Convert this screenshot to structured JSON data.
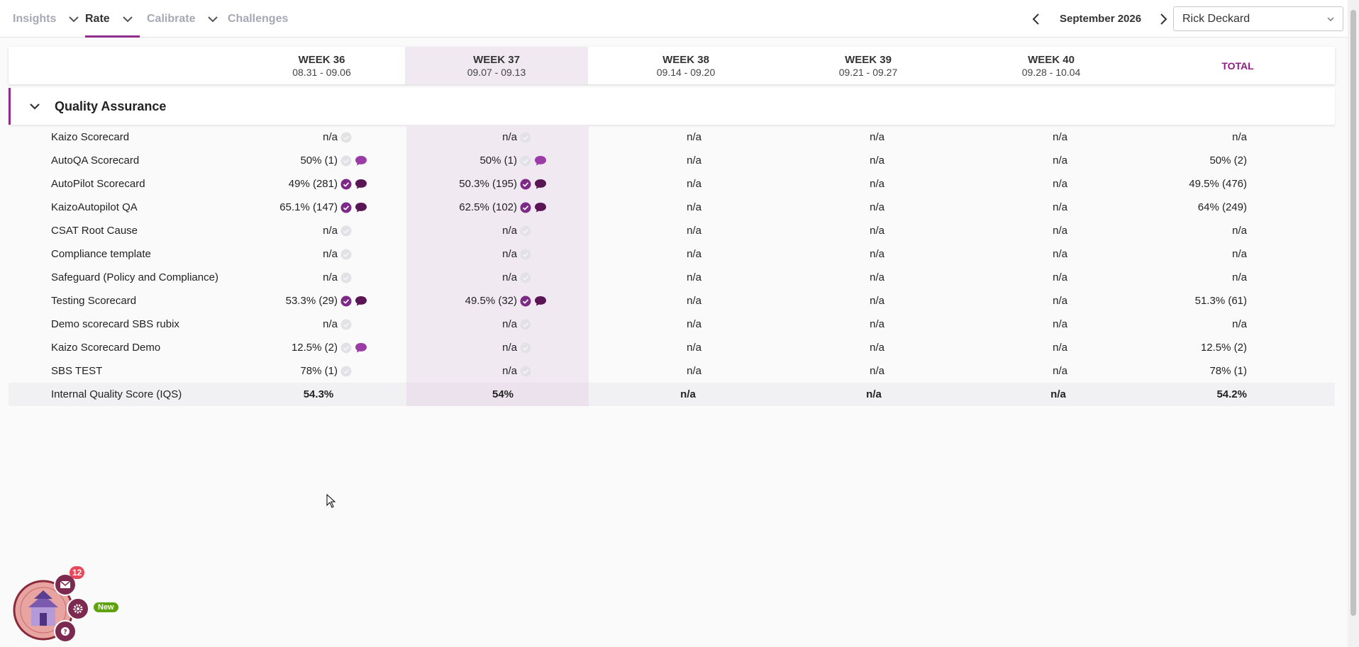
{
  "nav": {
    "items": [
      {
        "label": "Insights",
        "has_dropdown": true,
        "active": false
      },
      {
        "label": "Rate",
        "has_dropdown": true,
        "active": true
      },
      {
        "label": "Calibrate",
        "has_dropdown": true,
        "active": false
      },
      {
        "label": "Challenges",
        "has_dropdown": false,
        "active": false
      }
    ]
  },
  "period": {
    "month_label": "September 2026"
  },
  "user_select": {
    "value": "Rick Deckard"
  },
  "columns": [
    {
      "week": "WEEK 36",
      "range": "08.31 - 09.06"
    },
    {
      "week": "WEEK 37",
      "range": "09.07 - 09.13"
    },
    {
      "week": "WEEK 38",
      "range": "09.14 - 09.20"
    },
    {
      "week": "WEEK 39",
      "range": "09.21 - 09.27"
    },
    {
      "week": "WEEK 40",
      "range": "09.28 - 10.04"
    }
  ],
  "total_label": "TOTAL",
  "section": {
    "title": "Quality Assurance"
  },
  "rows": [
    {
      "label": "Kaizo Scorecard",
      "cells": [
        {
          "v": "n/a",
          "check": "off",
          "chat": "none"
        },
        {
          "v": "n/a",
          "check": "off",
          "chat": "none"
        },
        {
          "v": "n/a"
        },
        {
          "v": "n/a"
        },
        {
          "v": "n/a"
        }
      ],
      "total": "n/a"
    },
    {
      "label": "AutoQA Scorecard",
      "cells": [
        {
          "v": "50% (1)",
          "check": "off",
          "chat": "light"
        },
        {
          "v": "50% (1)",
          "check": "off",
          "chat": "light"
        },
        {
          "v": "n/a"
        },
        {
          "v": "n/a"
        },
        {
          "v": "n/a"
        }
      ],
      "total": "50% (2)"
    },
    {
      "label": "AutoPilot Scorecard",
      "cells": [
        {
          "v": "49% (281)",
          "check": "on",
          "chat": "dark"
        },
        {
          "v": "50.3% (195)",
          "check": "on",
          "chat": "dark"
        },
        {
          "v": "n/a"
        },
        {
          "v": "n/a"
        },
        {
          "v": "n/a"
        }
      ],
      "total": "49.5% (476)"
    },
    {
      "label": "KaizoAutopilot QA",
      "cells": [
        {
          "v": "65.1% (147)",
          "check": "on",
          "chat": "dark"
        },
        {
          "v": "62.5% (102)",
          "check": "on",
          "chat": "dark"
        },
        {
          "v": "n/a"
        },
        {
          "v": "n/a"
        },
        {
          "v": "n/a"
        }
      ],
      "total": "64% (249)"
    },
    {
      "label": "CSAT Root Cause",
      "cells": [
        {
          "v": "n/a",
          "check": "off",
          "chat": "none"
        },
        {
          "v": "n/a",
          "check": "off",
          "chat": "none"
        },
        {
          "v": "n/a"
        },
        {
          "v": "n/a"
        },
        {
          "v": "n/a"
        }
      ],
      "total": "n/a"
    },
    {
      "label": "Compliance template",
      "cells": [
        {
          "v": "n/a",
          "check": "off",
          "chat": "none"
        },
        {
          "v": "n/a",
          "check": "off",
          "chat": "none"
        },
        {
          "v": "n/a"
        },
        {
          "v": "n/a"
        },
        {
          "v": "n/a"
        }
      ],
      "total": "n/a"
    },
    {
      "label": "Safeguard (Policy and Compliance)",
      "cells": [
        {
          "v": "n/a",
          "check": "off",
          "chat": "none"
        },
        {
          "v": "n/a",
          "check": "off",
          "chat": "none"
        },
        {
          "v": "n/a"
        },
        {
          "v": "n/a"
        },
        {
          "v": "n/a"
        }
      ],
      "total": "n/a"
    },
    {
      "label": "Testing Scorecard",
      "cells": [
        {
          "v": "53.3% (29)",
          "check": "on",
          "chat": "dark"
        },
        {
          "v": "49.5% (32)",
          "check": "on",
          "chat": "dark"
        },
        {
          "v": "n/a"
        },
        {
          "v": "n/a"
        },
        {
          "v": "n/a"
        }
      ],
      "total": "51.3% (61)"
    },
    {
      "label": "Demo scorecard SBS rubix",
      "cells": [
        {
          "v": "n/a",
          "check": "off",
          "chat": "none"
        },
        {
          "v": "n/a",
          "check": "off",
          "chat": "none"
        },
        {
          "v": "n/a"
        },
        {
          "v": "n/a"
        },
        {
          "v": "n/a"
        }
      ],
      "total": "n/a"
    },
    {
      "label": "Kaizo Scorecard Demo",
      "cells": [
        {
          "v": "12.5% (2)",
          "check": "off",
          "chat": "light"
        },
        {
          "v": "n/a",
          "check": "off",
          "chat": "none"
        },
        {
          "v": "n/a"
        },
        {
          "v": "n/a"
        },
        {
          "v": "n/a"
        }
      ],
      "total": "12.5% (2)"
    },
    {
      "label": "SBS TEST",
      "cells": [
        {
          "v": "78% (1)",
          "check": "off",
          "chat": "none"
        },
        {
          "v": "n/a",
          "check": "off",
          "chat": "none"
        },
        {
          "v": "n/a"
        },
        {
          "v": "n/a"
        },
        {
          "v": "n/a"
        }
      ],
      "total": "78% (1)"
    }
  ],
  "iqs": {
    "label": "Internal Quality Score (IQS)",
    "values": [
      "54.3%",
      "54%",
      "n/a",
      "n/a",
      "n/a"
    ],
    "total": "54.2%"
  },
  "widget": {
    "badge_count": "12",
    "new_label": "New"
  },
  "colors": {
    "accent": "#8e2d8a",
    "check_on": "#7d2a86",
    "check_off": "#e2e2e6",
    "chat_dark": "#5a1554",
    "chat_light": "#9b3ba6",
    "new_badge": "#5fa10f",
    "count_badge": "#e8495a"
  }
}
